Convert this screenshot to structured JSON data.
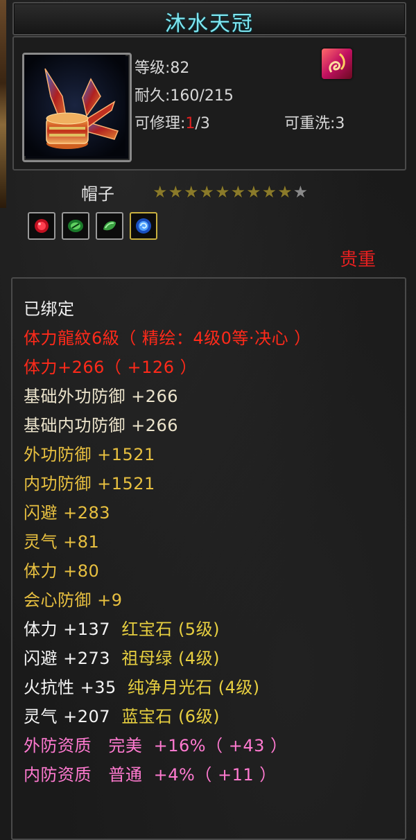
{
  "item": {
    "name": "沐水天冠",
    "level_label": "等级:",
    "level_value": "82",
    "durability_label": "耐久:",
    "durability_value": "160/215",
    "repair_label": "可修理:",
    "repair_current": "1",
    "repair_total": "/3",
    "rewash_label": "可重洗:",
    "rewash_value": "3",
    "type": "帽子",
    "stars_filled": 9,
    "stars_total": 10,
    "rarity": "贵重",
    "gem_icons": [
      "ruby-gem-icon",
      "emerald-gem-icon",
      "jade-gem-icon",
      "sapphire-gem-icon"
    ],
    "colors": {
      "title": "#7fe6f0",
      "rarity": "#e82020",
      "star": "#8a7a2a",
      "star_dim": "#8a8a8a"
    }
  },
  "attributes": [
    {
      "text": "已绑定",
      "color": "white"
    },
    {
      "text": "体力龍紋6級（ 精绘：4级0等·决心 ）",
      "color": "red"
    },
    {
      "text": "体力+266（ +126 ）",
      "color": "red"
    },
    {
      "text": "基础外功防御  +266",
      "color": "beige"
    },
    {
      "text": "基础内功防御  +266",
      "color": "beige"
    },
    {
      "text": "外功防御  +1521",
      "color": "yellow"
    },
    {
      "text": "内功防御  +1521",
      "color": "yellow"
    },
    {
      "text": "闪避  +283",
      "color": "yellow"
    },
    {
      "text": "灵气  +81",
      "color": "yellow"
    },
    {
      "text": "体力  +80",
      "color": "yellow"
    },
    {
      "text": "会心防御  +9",
      "color": "yellow"
    }
  ],
  "gem_attributes": [
    {
      "stat": "体力 +137",
      "gem": "红宝石 (5级)"
    },
    {
      "stat": "闪避 +273",
      "gem": "祖母绿 (4级)"
    },
    {
      "stat": "火抗性 +35",
      "gem": "纯净月光石 (4级)"
    },
    {
      "stat": "灵气 +207",
      "gem": "蓝宝石 (6级)"
    }
  ],
  "qualities": [
    {
      "label": "外防资质",
      "grade": "完美",
      "bonus": "+16%（ +43 ）"
    },
    {
      "label": "内防资质",
      "grade": "普通",
      "bonus": "+4%（ +11 ）"
    }
  ]
}
